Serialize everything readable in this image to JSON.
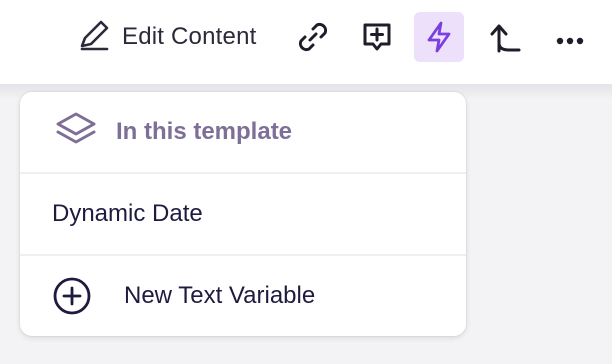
{
  "toolbar": {
    "edit_label": "Edit Content",
    "icons": {
      "edit": "pencil-icon",
      "link": "link-icon",
      "comment": "add-comment-icon",
      "dynamic": "lightning-icon",
      "move_up": "arrow-up-turn-icon",
      "more": "more-horizontal-icon"
    },
    "active_icon": "lightning-icon",
    "active_bg": "#ece0fb",
    "active_color": "#7b3fe0"
  },
  "dropdown": {
    "header": {
      "title": "In this template",
      "icon": "layers-icon",
      "color": "#7e6f97"
    },
    "items": [
      {
        "label": "Dynamic Date"
      }
    ],
    "new_item": {
      "label": "New Text Variable",
      "icon": "plus-circle-icon"
    }
  }
}
